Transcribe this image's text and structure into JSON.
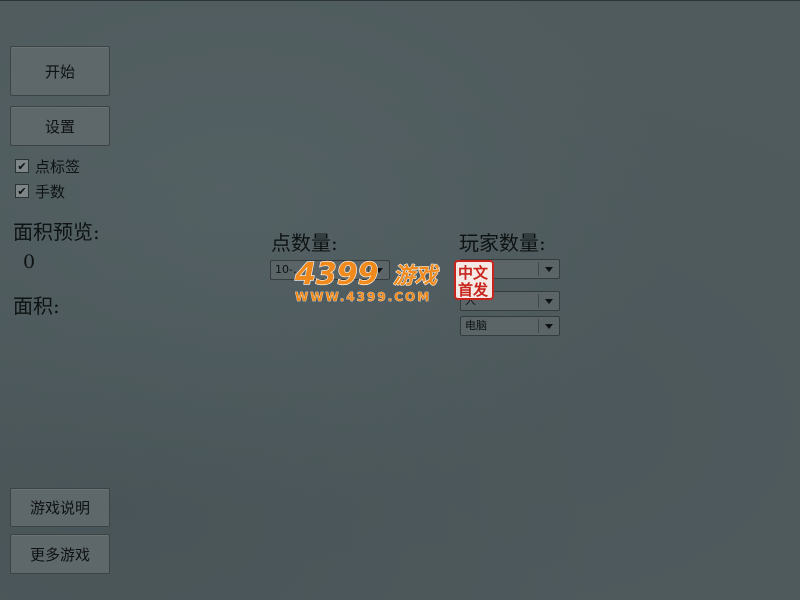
{
  "menu": {
    "start_label": "开始",
    "settings_label": "设置",
    "help_label": "游戏说明",
    "more_games_label": "更多游戏"
  },
  "options": {
    "point_labels": {
      "label": "点标签",
      "checked": true
    },
    "move_count": {
      "label": "手数",
      "checked": true
    }
  },
  "stats": {
    "area_preview_label": "面积预览:",
    "area_preview_value": "0",
    "area_label": "面积:"
  },
  "config": {
    "points_label": "点数量:",
    "points_value": "10-…",
    "players_label": "玩家数量:",
    "players_value": "",
    "player_1_type": "人",
    "player_2_type": "电脑"
  },
  "watermark": {
    "logo_text": "4399游戏",
    "url_text": "WWW.4399.COM",
    "badge_text": "中文首发",
    "colors": {
      "logo_orange": "#f08a1c",
      "badge_red": "#c8241c"
    }
  },
  "colors": {
    "background": "#4f5b5d",
    "button_face": "#5e6769",
    "text": "#0e1213"
  }
}
